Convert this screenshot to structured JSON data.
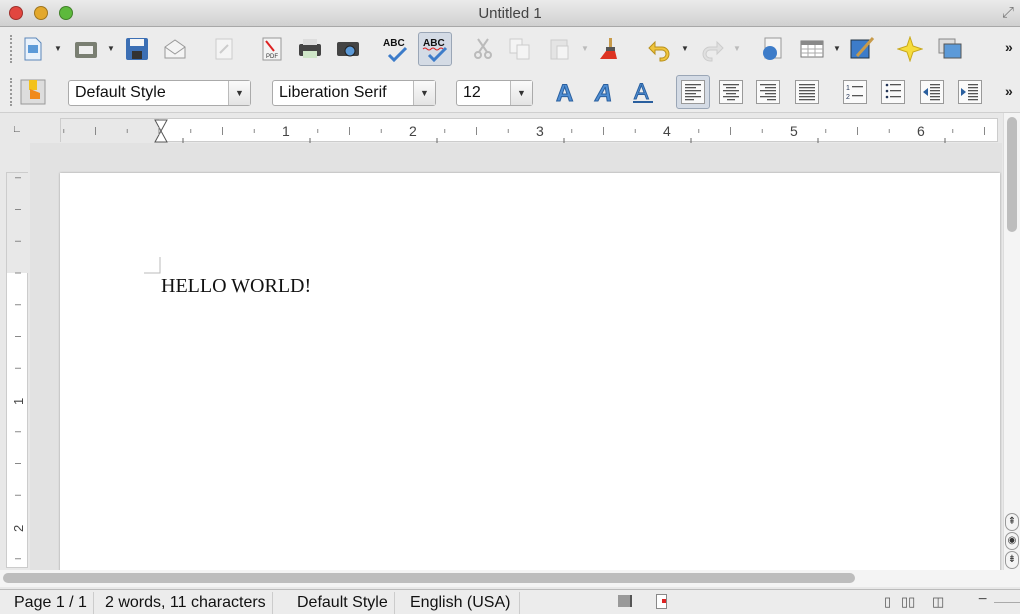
{
  "window": {
    "title": "Untitled 1"
  },
  "toolbar_standard": [
    {
      "name": "new-document",
      "icon": "new-doc-icon",
      "dropdown": true
    },
    {
      "name": "open",
      "icon": "folder-icon",
      "dropdown": true
    },
    {
      "name": "save",
      "icon": "floppy-icon"
    },
    {
      "name": "email",
      "icon": "envelope-icon"
    },
    {
      "name": "edit-mode",
      "icon": "edit-doc-icon",
      "disabled": true
    },
    {
      "name": "export-pdf",
      "icon": "pdf-icon"
    },
    {
      "name": "print",
      "icon": "printer-icon"
    },
    {
      "name": "print-preview",
      "icon": "preview-icon"
    },
    {
      "name": "spelling",
      "icon": "spellcheck-icon",
      "text": "ABC"
    },
    {
      "name": "autospellcheck",
      "icon": "autospell-icon",
      "text": "ABC",
      "active": true
    },
    {
      "name": "cut",
      "icon": "scissors-icon",
      "disabled": true
    },
    {
      "name": "copy",
      "icon": "copy-icon",
      "disabled": true
    },
    {
      "name": "paste",
      "icon": "paste-icon",
      "disabled": true,
      "dropdown": true
    },
    {
      "name": "clone-formatting",
      "icon": "paintbrush-icon"
    },
    {
      "name": "undo",
      "icon": "undo-icon",
      "dropdown": true
    },
    {
      "name": "redo",
      "icon": "redo-icon",
      "disabled": true,
      "dropdown": true
    },
    {
      "name": "navigator",
      "icon": "globe-doc-icon"
    },
    {
      "name": "table",
      "icon": "table-icon",
      "dropdown": true
    },
    {
      "name": "drawing",
      "icon": "draw-icon"
    },
    {
      "name": "navigator-star",
      "icon": "star-icon"
    },
    {
      "name": "gallery",
      "icon": "gallery-icon"
    }
  ],
  "toolbar_formatting": {
    "paragraph_style": "Default Style",
    "font_name": "Liberation Serif",
    "font_size": "12",
    "buttons": [
      {
        "name": "bold",
        "icon": "bold-icon"
      },
      {
        "name": "italic",
        "icon": "italic-icon"
      },
      {
        "name": "underline",
        "icon": "underline-icon"
      },
      {
        "name": "align-left",
        "icon": "align-left-icon",
        "active": true
      },
      {
        "name": "align-center",
        "icon": "align-center-icon"
      },
      {
        "name": "align-right",
        "icon": "align-right-icon"
      },
      {
        "name": "justify",
        "icon": "justify-icon"
      },
      {
        "name": "numbering",
        "icon": "numbered-list-icon"
      },
      {
        "name": "bullets",
        "icon": "bullet-list-icon"
      },
      {
        "name": "decrease-indent",
        "icon": "decrease-indent-icon"
      },
      {
        "name": "increase-indent",
        "icon": "increase-indent-icon"
      }
    ]
  },
  "overflow": "»",
  "ruler": {
    "h_labels": [
      "1",
      "2",
      "3",
      "4",
      "5",
      "6"
    ],
    "v_labels": [
      "1",
      "2"
    ]
  },
  "document": {
    "text": "HELLO WORLD!"
  },
  "status": {
    "page": "Page 1 / 1",
    "words": "2 words, 11 characters",
    "style": "Default Style",
    "language": "English (USA)"
  },
  "colors": {
    "accent": "#3d7cc9",
    "active_bg": "#d4dbe5"
  }
}
